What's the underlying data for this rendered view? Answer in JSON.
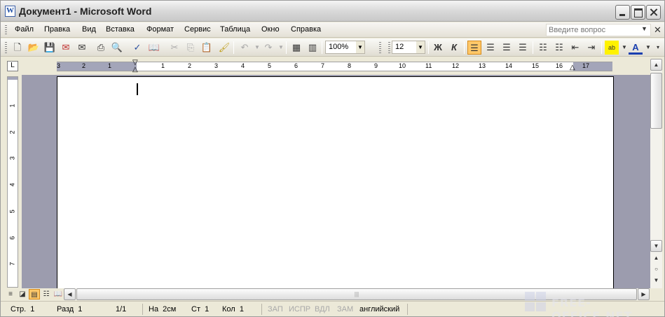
{
  "window": {
    "title": "Документ1 - Microsoft Word"
  },
  "menu": {
    "items": [
      "Файл",
      "Правка",
      "Вид",
      "Вставка",
      "Формат",
      "Сервис",
      "Таблица",
      "Окно",
      "Справка"
    ],
    "help_placeholder": "Введите вопрос"
  },
  "toolbar": {
    "zoom": "100%",
    "font_size": "12",
    "bold": "Ж",
    "italic": "К",
    "text_color_label": "A"
  },
  "ruler": {
    "h_numbers": [
      "3",
      "2",
      "1",
      "1",
      "2",
      "3",
      "4",
      "5",
      "6",
      "7",
      "8",
      "9",
      "10",
      "11",
      "12",
      "13",
      "14",
      "15",
      "16",
      "17"
    ],
    "v_numbers": [
      "1",
      "1",
      "2",
      "3",
      "4",
      "5",
      "6",
      "7"
    ]
  },
  "status": {
    "page": "Стр.  1",
    "section": "Разд  1",
    "pages": "1/1",
    "at": "На  2см",
    "line": "Ст  1",
    "col": "Кол  1",
    "rec": "ЗАП",
    "trk": "ИСПР",
    "ext": "ВДЛ",
    "ovr": "ЗАМ",
    "language": "английский"
  },
  "watermark": {
    "text": "FREE-OFFICE.NET"
  },
  "colors": {
    "title_bg": "#d9d9d9",
    "ruler_margin": "#a3a5b9",
    "doc_bg": "#9c9cae",
    "active_button": "#ffc869"
  }
}
